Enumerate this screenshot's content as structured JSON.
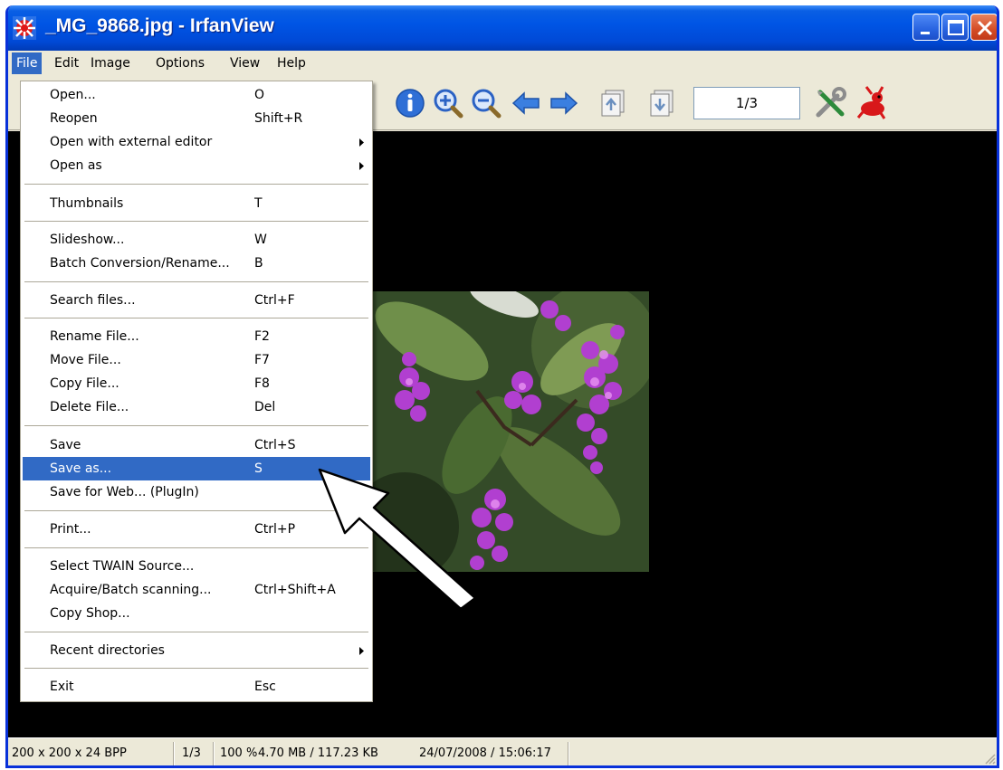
{
  "window": {
    "title": "_MG_9868.jpg - IrfanView",
    "controls": [
      "minimize-icon",
      "maximize-icon",
      "close-icon"
    ]
  },
  "menubar": {
    "items": [
      "File",
      "Edit",
      "Image",
      "Options",
      "View",
      "Help"
    ],
    "active": "File"
  },
  "toolbar": {
    "icons": [
      "info-icon",
      "zoom-in-icon",
      "zoom-out-icon",
      "previous-arrow-icon",
      "next-arrow-icon",
      "page-up-icon",
      "page-down-icon",
      "tools-icon",
      "irfanview-logo-icon"
    ],
    "page_field": "1/3"
  },
  "file_menu": {
    "items": [
      {
        "label": "Open...",
        "shortcut": "O",
        "submenu": false
      },
      {
        "label": "Reopen",
        "shortcut": "Shift+R",
        "submenu": false
      },
      {
        "label": "Open with external editor",
        "shortcut": "",
        "submenu": true
      },
      {
        "label": "Open as",
        "shortcut": "",
        "submenu": true
      },
      {
        "label": "Thumbnails",
        "shortcut": "T",
        "submenu": false
      },
      {
        "label": "Slideshow...",
        "shortcut": "W",
        "submenu": false
      },
      {
        "label": "Batch Conversion/Rename...",
        "shortcut": "B",
        "submenu": false
      },
      {
        "label": "Search files...",
        "shortcut": "Ctrl+F",
        "submenu": false
      },
      {
        "label": "Rename File...",
        "shortcut": "F2",
        "submenu": false
      },
      {
        "label": "Move File...",
        "shortcut": "F7",
        "submenu": false
      },
      {
        "label": "Copy File...",
        "shortcut": "F8",
        "submenu": false
      },
      {
        "label": "Delete File...",
        "shortcut": "Del",
        "submenu": false
      },
      {
        "label": "Save",
        "shortcut": "Ctrl+S",
        "submenu": false
      },
      {
        "label": "Save as...",
        "shortcut": "S",
        "submenu": false,
        "highlighted": true
      },
      {
        "label": "Save for Web... (PlugIn)",
        "shortcut": "",
        "submenu": false
      },
      {
        "label": "Print...",
        "shortcut": "Ctrl+P",
        "submenu": false
      },
      {
        "label": "Select TWAIN Source...",
        "shortcut": "",
        "submenu": false
      },
      {
        "label": "Acquire/Batch scanning...",
        "shortcut": "Ctrl+Shift+A",
        "submenu": false
      },
      {
        "label": "Copy Shop...",
        "shortcut": "",
        "submenu": false
      },
      {
        "label": "Recent directories",
        "shortcut": "",
        "submenu": true
      },
      {
        "label": "Exit",
        "shortcut": "Esc",
        "submenu": false
      }
    ]
  },
  "statusbar": {
    "dimensions": "200 x 200 x 24 BPP",
    "page": "1/3",
    "zoom": "100 %",
    "memory": "4.70 MB / 117.23 KB",
    "datetime": "24/07/2008 / 15:06:17"
  },
  "colors": {
    "title_bar": "#0055e5",
    "menu_highlight": "#316ac5",
    "viewer_background": "#000000",
    "window_face": "#ece9d8"
  }
}
